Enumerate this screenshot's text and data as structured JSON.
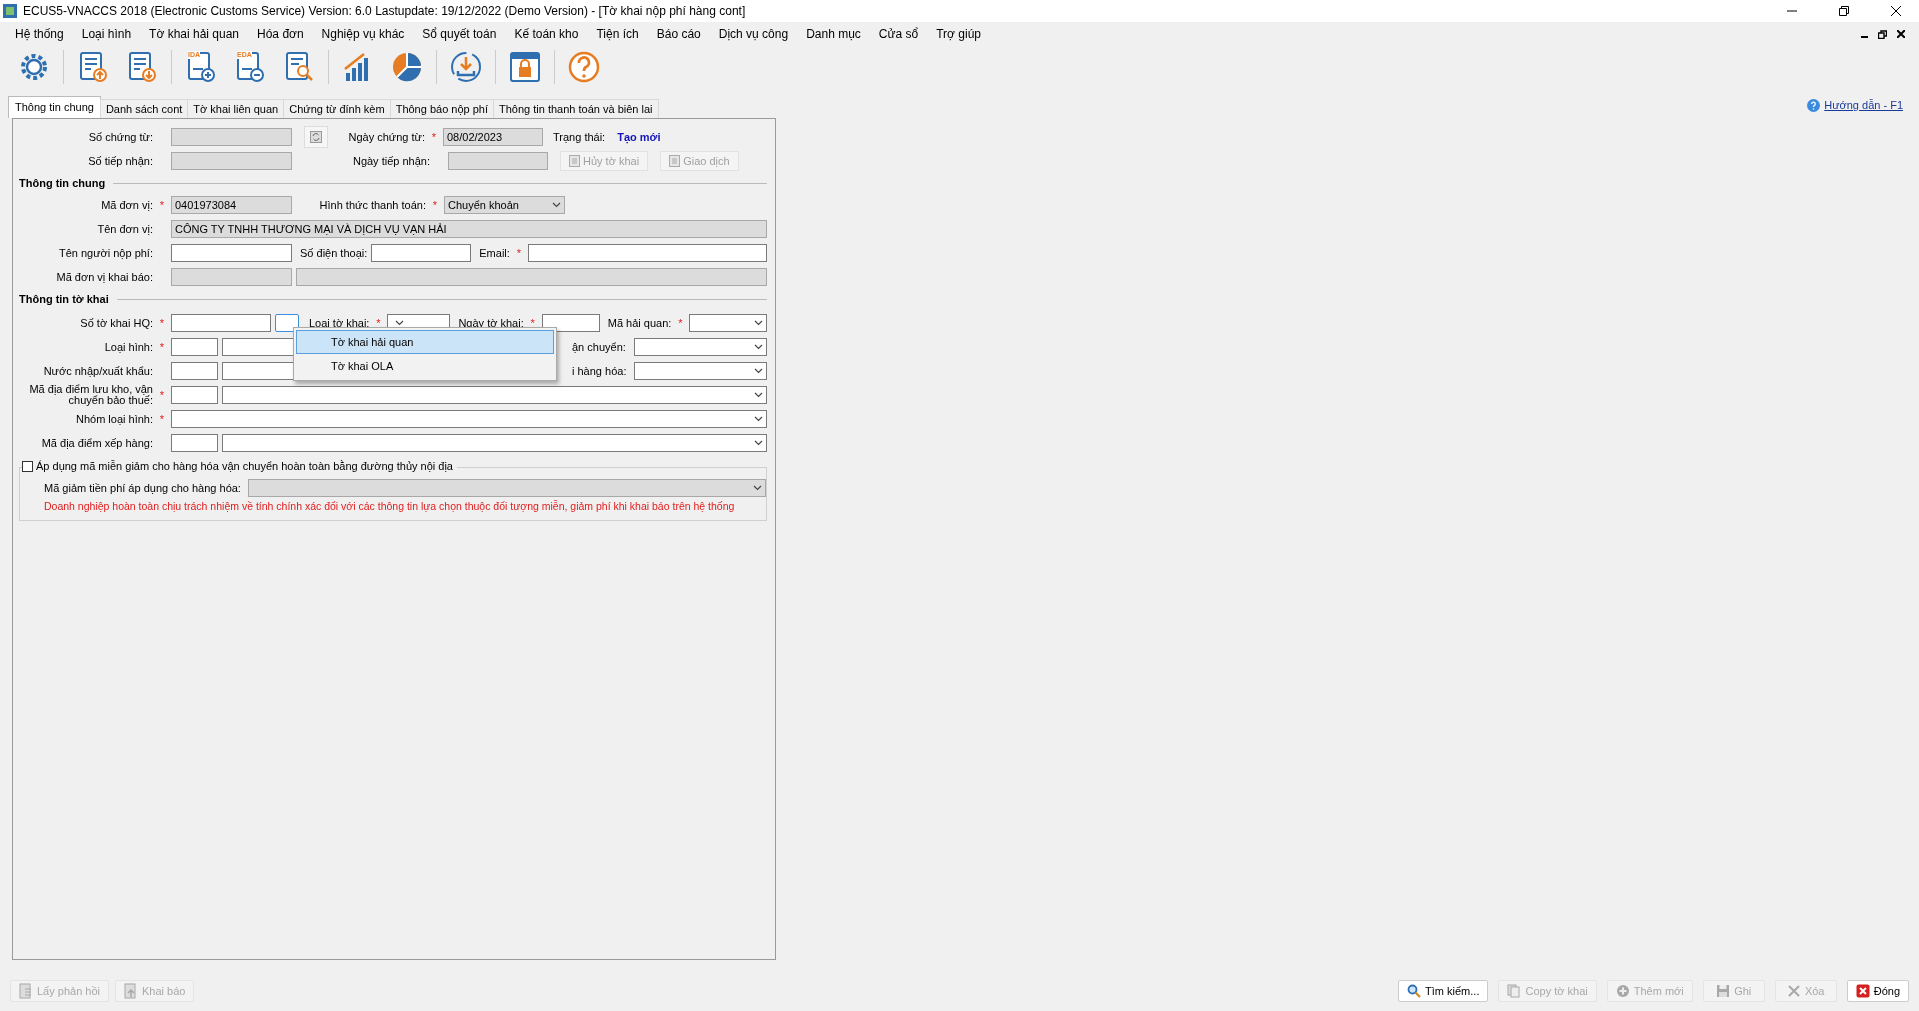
{
  "window": {
    "title": "ECUS5-VNACCS 2018 (Electronic Customs Service) Version: 6.0 Lastupdate: 19/12/2022 (Demo Version) - [Tờ khai nộp phí hàng cont]"
  },
  "menu": [
    "Hệ thống",
    "Loại hình",
    "Tờ khai hải quan",
    "Hóa đơn",
    "Nghiệp vụ khác",
    "Sổ quyết toán",
    "Kế toán kho",
    "Tiện ích",
    "Báo cáo",
    "Dịch vụ công",
    "Danh mục",
    "Cửa sổ",
    "Trợ giúp"
  ],
  "toolbar": [
    {
      "kind": "settings"
    },
    {
      "kind": "upload"
    },
    {
      "kind": "download"
    },
    {
      "kind": "add",
      "badge": "IDA"
    },
    {
      "kind": "remove",
      "badge": "EDA"
    },
    {
      "kind": "search"
    },
    {
      "kind": "chart"
    },
    {
      "kind": "pie"
    },
    {
      "kind": "sync"
    },
    {
      "kind": "lock"
    },
    {
      "kind": "help"
    }
  ],
  "tabs": [
    {
      "label": "Thông tin chung",
      "selected": true
    },
    {
      "label": "Danh sách cont",
      "selected": false
    },
    {
      "label": "Tờ khai liên quan",
      "selected": false
    },
    {
      "label": "Chứng từ đính kèm",
      "selected": false
    },
    {
      "label": "Thông báo nộp phí",
      "selected": false
    },
    {
      "label": "Thông tin thanh toán và biên lai",
      "selected": false
    }
  ],
  "help_link": "Hướng dẫn - F1",
  "header": {
    "so_chung_tu": {
      "label": "Số chứng từ:",
      "disabled": true
    },
    "ngay_chung_tu": {
      "label": "Ngày chứng từ:",
      "required_mark": "*",
      "value": "08/02/2023",
      "disabled": true
    },
    "trang_thai": {
      "label": "Trạng thái:",
      "value": "Tạo mới"
    },
    "so_tiep_nhan": {
      "label": "Số tiếp nhận:",
      "disabled": true
    },
    "ngay_tiep_nhan": {
      "label": "Ngày tiếp nhận:",
      "disabled": true
    },
    "huy_to_khai": {
      "label": "Hủy tờ khai",
      "disabled": true
    },
    "giao_dich": {
      "label": "Giao dịch",
      "disabled": true
    }
  },
  "general": {
    "title": "Thông tin chung",
    "ma_don_vi": {
      "label": "Mã đơn vị:",
      "required_mark": "*",
      "value": "0401973084",
      "disabled": true
    },
    "hinh_thuc_thanh_toan": {
      "label": "Hình thức thanh toán:",
      "required_mark": "*",
      "value": "Chuyển khoản",
      "disabled": true
    },
    "ten_don_vi": {
      "label": "Tên đơn vị:",
      "value": "CÔNG TY TNHH THƯƠNG MẠI VÀ DỊCH VỤ VẠN HẢI",
      "disabled": true
    },
    "ten_nguoi_nop_phi": {
      "label": "Tên người nộp phí:",
      "disabled": false
    },
    "so_dien_thoai": {
      "label": "Số điện thoại:",
      "disabled": false
    },
    "email": {
      "label": "Email:",
      "required_mark": "*",
      "disabled": false
    },
    "ma_don_vi_khai_bao": {
      "label": "Mã đơn vị khai báo:",
      "disabled": true
    }
  },
  "declaration": {
    "title": "Thông tin tờ khai",
    "so_to_khai_hq": {
      "label": "Số tờ khai HQ:",
      "required_mark": "*",
      "disabled": false
    },
    "loai_to_khai": {
      "label": "Loại tờ khai:",
      "required_mark": "*",
      "disabled": false
    },
    "ngay_to_khai": {
      "label": "Ngày tờ khai:",
      "required_mark": "*",
      "disabled": false
    },
    "ma_hai_quan": {
      "label": "Mã hải quan:",
      "required_mark": "*",
      "disabled": false
    },
    "loai_hinh": {
      "label": "Loại hình:",
      "required_mark": "*",
      "disabled": false
    },
    "van_chuyen": {
      "label": "ận chuyển:",
      "disabled": false
    },
    "nuoc": {
      "label": "Nước nhập/xuất khẩu:",
      "disabled": false
    },
    "hang_hoa": {
      "label": "i hàng hóa:",
      "disabled": false
    },
    "luu_kho": {
      "label": "Mã địa điểm lưu kho, vận chuyển bảo thuế:",
      "required_mark": "*",
      "disabled": false
    },
    "nhom_loai_hinh": {
      "label": "Nhóm loại hình:",
      "required_mark": "*",
      "disabled": false
    },
    "xep_hang": {
      "label": "Mã địa điểm xếp hàng:",
      "disabled": false
    },
    "mien_giam": {
      "label": "Áp dụng mã miễn giảm cho hàng hóa vận chuyển hoàn toàn bằng đường thủy nội địa",
      "checked": false
    },
    "ma_giam": {
      "label": "Mã giảm tiền phí áp dụng cho hàng hóa:",
      "disabled": true
    },
    "notice": "Doanh nghiệp hoàn toàn chịu trách nhiệm về tính chính xác đối với các thông tin lựa chọn thuộc đối tượng miễn, giảm phí khi khai báo trên hệ thống"
  },
  "dropdown": {
    "items": [
      {
        "label": "Tờ khai hải quan",
        "selected": true
      },
      {
        "label": "Tờ khai OLA",
        "selected": false
      }
    ]
  },
  "bottom_left": [
    {
      "kind": "receive",
      "label": "Lấy phản hồi",
      "disabled": true
    },
    {
      "kind": "send",
      "label": "Khai báo",
      "disabled": true
    }
  ],
  "bottom_right": [
    {
      "kind": "search",
      "label": "Tìm kiếm...",
      "disabled": false
    },
    {
      "kind": "copy",
      "label": "Copy tờ khai",
      "disabled": true
    },
    {
      "kind": "add",
      "label": "Thêm mới",
      "disabled": true
    },
    {
      "kind": "save",
      "label": "Ghi",
      "disabled": true
    },
    {
      "kind": "delete",
      "label": "Xóa",
      "disabled": true
    },
    {
      "kind": "close",
      "label": "Đóng",
      "disabled": false
    }
  ]
}
